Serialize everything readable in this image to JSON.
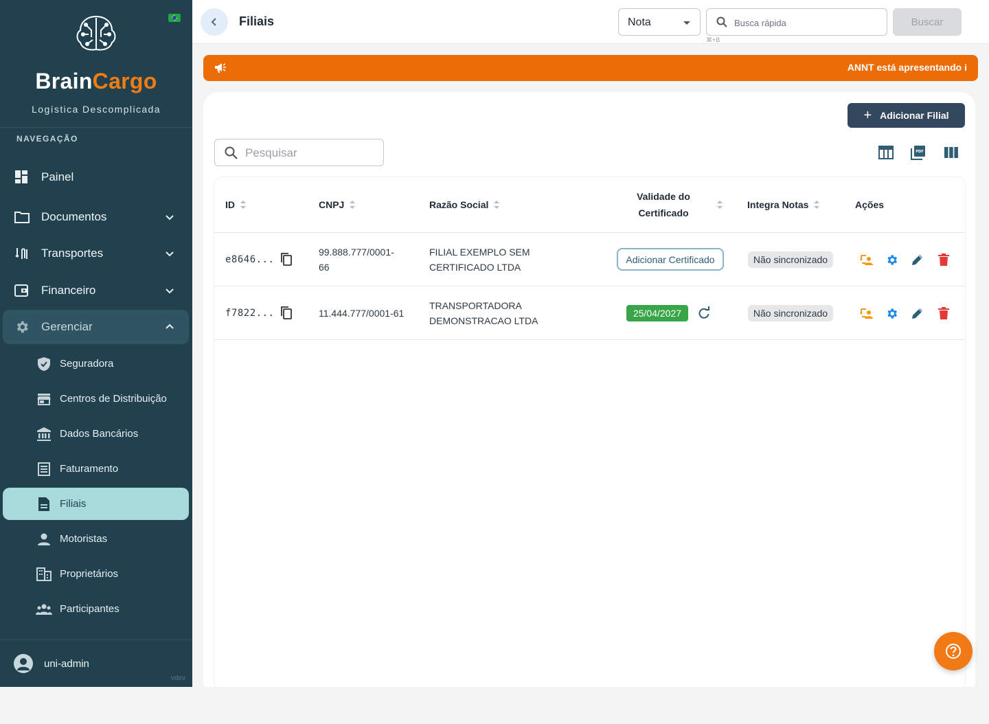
{
  "brand": {
    "name_part1": "Brain",
    "name_part2": "Cargo",
    "tagline": "Logística Descomplicada",
    "colors": {
      "sidebar": "#22414f",
      "accent": "#f07c12",
      "selected": "#a8dadb"
    }
  },
  "sidebar": {
    "heading": "NAVEGAÇÃO",
    "items": [
      {
        "label": "Painel",
        "icon": "dashboard-icon"
      },
      {
        "label": "Documentos",
        "icon": "folder-icon"
      },
      {
        "label": "Transportes",
        "icon": "route-icon"
      },
      {
        "label": "Financeiro",
        "icon": "wallet-icon"
      },
      {
        "label": "Gerenciar",
        "icon": "gear-icon"
      }
    ],
    "subitems": [
      {
        "label": "Seguradora",
        "icon": "shield-icon"
      },
      {
        "label": "Centros de Distribuição",
        "icon": "store-icon"
      },
      {
        "label": "Dados Bancários",
        "icon": "bank-icon"
      },
      {
        "label": "Faturamento",
        "icon": "receipt-icon"
      },
      {
        "label": "Filiais",
        "icon": "document-icon"
      },
      {
        "label": "Motoristas",
        "icon": "person-icon"
      },
      {
        "label": "Proprietários",
        "icon": "building-icon"
      },
      {
        "label": "Participantes",
        "icon": "group-icon"
      }
    ],
    "user": {
      "name": "uni-admin",
      "version": "vdev"
    }
  },
  "header": {
    "title": "Filiais",
    "select_value": "Nota",
    "quick_search_placeholder": "Busca rápida",
    "shortcut": "⌘+B",
    "search_button": "Buscar"
  },
  "announcement": {
    "text": "ANNT está apresentando i"
  },
  "toolbar": {
    "add_button": "Adicionar Filial",
    "search_placeholder": "Pesquisar"
  },
  "table": {
    "columns": {
      "id": "ID",
      "cnpj": "CNPJ",
      "razao": "Razão Social",
      "validade_1": "Validade do",
      "validade_2": "Certificado",
      "integra": "Integra Notas",
      "acoes": "Ações"
    },
    "rows": [
      {
        "id": "e8646...",
        "cnpj_1": "99.888.777/0001-",
        "cnpj_2": "66",
        "razao_1": "FILIAL EXEMPLO SEM",
        "razao_2": "CERTIFICADO LTDA",
        "certificate_action": "Adicionar Certificado",
        "integra": "Não sincronizado"
      },
      {
        "id": "f7822...",
        "cnpj_1": "11.444.777/0001-61",
        "razao_1": "TRANSPORTADORA",
        "razao_2": "DEMONSTRACAO LTDA",
        "validade": "25/04/2027",
        "integra": "Não sincronizado"
      }
    ]
  }
}
